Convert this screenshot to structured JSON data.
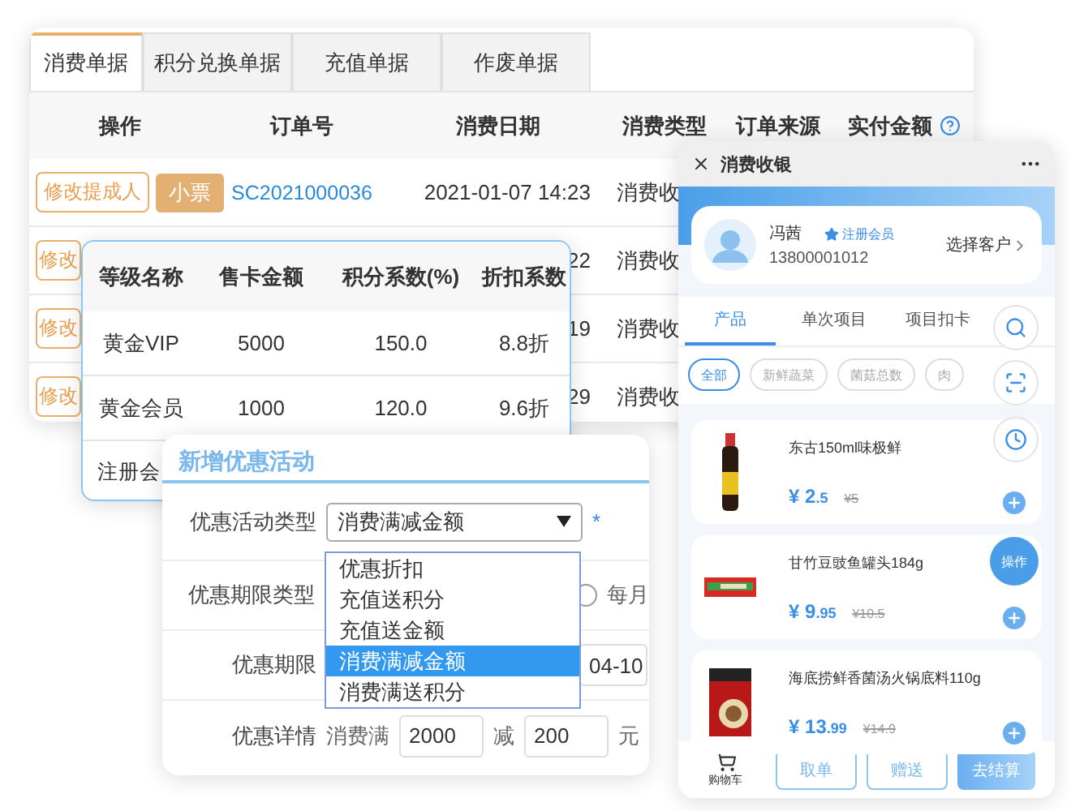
{
  "orders_panel": {
    "tabs": [
      {
        "label": "消费单据",
        "selected": true
      },
      {
        "label": "积分兑换单据",
        "selected": false
      },
      {
        "label": "充值单据",
        "selected": false
      },
      {
        "label": "作废单据",
        "selected": false
      }
    ],
    "columns": [
      "操作",
      "订单号",
      "消费日期",
      "消费类型",
      "订单来源",
      "实付金额"
    ],
    "rows": [
      {
        "action": "修改提成人",
        "receipt": "小票",
        "order_no": "SC2021000036",
        "date": "2021-01-07 14:23",
        "type": "消费收"
      },
      {
        "action": "修改",
        "date": "22",
        "type": "消费收"
      },
      {
        "action": "修改",
        "date": "19",
        "type": "消费收"
      },
      {
        "action": "修改",
        "date": "29",
        "type": "消费收"
      }
    ]
  },
  "level_panel": {
    "columns": [
      "等级名称",
      "售卡金额",
      "积分系数(%)",
      "折扣系数"
    ],
    "rows": [
      [
        "黄金VIP",
        "5000",
        "150.0",
        "8.8折"
      ],
      [
        "黄金会员",
        "1000",
        "120.0",
        "9.6折"
      ],
      [
        "注册会"
      ]
    ]
  },
  "promo_form": {
    "title": "新增优惠活动",
    "fields": [
      {
        "kind": "select",
        "label": "优惠活动类型",
        "value": "消费满减金额",
        "required_mark": "*",
        "options": [
          {
            "label": "优惠折扣",
            "selected": false
          },
          {
            "label": "充值送积分",
            "selected": false
          },
          {
            "label": "充值送金额",
            "selected": false
          },
          {
            "label": "消费满减金额",
            "selected": true
          },
          {
            "label": "消费满送积分",
            "selected": false
          }
        ]
      },
      {
        "kind": "radio",
        "label": "优惠期限类型",
        "option": "每月",
        "selected": false
      },
      {
        "kind": "date",
        "label": "优惠期限",
        "value": "04-10"
      },
      {
        "kind": "amount",
        "label": "优惠详情",
        "prefix": "消费满",
        "min": "2000",
        "middle": "减",
        "discount": "200",
        "unit": "元"
      }
    ]
  },
  "cashier": {
    "title": "消费收银",
    "customer": {
      "name": "冯茜",
      "tag": "注册会员",
      "phone": "13800001012",
      "action": "选择客户"
    },
    "tabs": [
      {
        "label": "产品",
        "selected": true
      },
      {
        "label": "单次项目",
        "selected": false
      },
      {
        "label": "项目扣卡",
        "selected": false
      }
    ],
    "chips": [
      {
        "label": "全部",
        "selected": true
      },
      {
        "label": "新鲜蔬菜",
        "selected": false
      },
      {
        "label": "菌菇总数",
        "selected": false
      },
      {
        "label": "肉",
        "selected": false
      }
    ],
    "products": [
      {
        "name": "东古150ml味极鲜",
        "currency": "¥",
        "price_int": "2",
        "price_dec": ".5",
        "old_price": "¥5",
        "kind": "bottle"
      },
      {
        "name": "甘竹豆豉鱼罐头184g",
        "currency": "¥",
        "price_int": "9",
        "price_dec": ".95",
        "old_price": "¥10.5",
        "kind": "can"
      },
      {
        "name": "海底捞鲜香菌汤火锅底料110g",
        "currency": "¥",
        "price_int": "13",
        "price_dec": ".99",
        "old_price": "¥14.9",
        "kind": "pack"
      }
    ],
    "fab": "操作",
    "cart": "购物车",
    "buttons": [
      "取单",
      "赠送"
    ],
    "checkout": "去结算"
  }
}
